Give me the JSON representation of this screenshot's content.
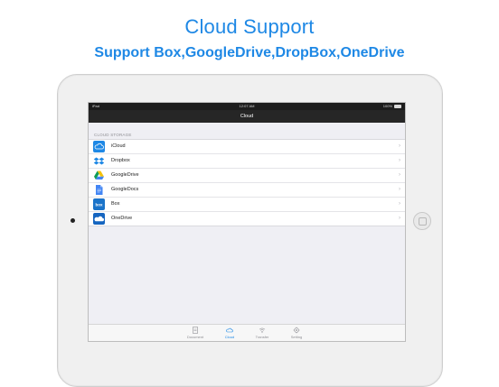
{
  "promo": {
    "title": "Cloud Support",
    "subtitle": "Support Box,GoogleDrive,DropBox,OneDrive"
  },
  "status_bar": {
    "carrier": "iPad",
    "time": "12:07 AM",
    "battery": "100%"
  },
  "nav": {
    "title": "Cloud"
  },
  "section": {
    "header": "CLOUD STORAGE"
  },
  "storage_items": [
    {
      "label": "iCloud",
      "icon": "icloud-icon"
    },
    {
      "label": "Dropbox",
      "icon": "dropbox-icon"
    },
    {
      "label": "GoogleDrive",
      "icon": "google-drive-icon"
    },
    {
      "label": "GoogleDocs",
      "icon": "google-docs-icon"
    },
    {
      "label": "Box",
      "icon": "box-icon"
    },
    {
      "label": "OneDrive",
      "icon": "onedrive-icon"
    }
  ],
  "tabs": [
    {
      "label": "Document",
      "icon": "document-icon",
      "active": false
    },
    {
      "label": "Cloud",
      "icon": "cloud-icon",
      "active": true
    },
    {
      "label": "Transfer",
      "icon": "wifi-icon",
      "active": false
    },
    {
      "label": "Setting",
      "icon": "gear-icon",
      "active": false
    }
  ],
  "colors": {
    "accent": "#1e88e5",
    "navbar": "#262626",
    "background": "#efeff4"
  },
  "box_logo_text": "box"
}
